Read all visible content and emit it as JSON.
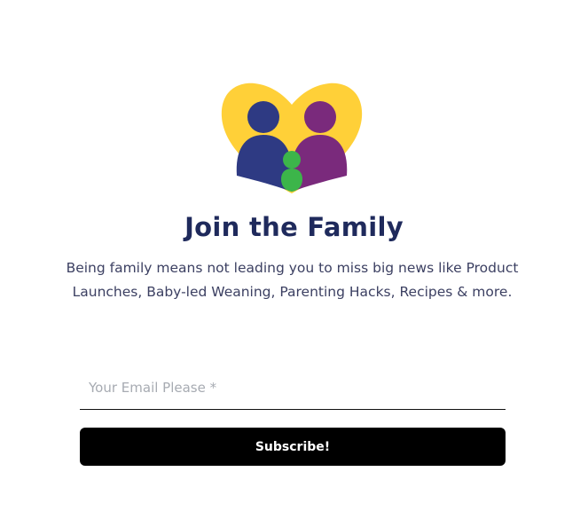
{
  "logo": {
    "icon": "family-heart-icon",
    "colors": {
      "heart": "#ffd038",
      "parent_left": "#2e3a83",
      "parent_right": "#7a2a7c",
      "child": "#3cb54a",
      "accent": "#f2a55a"
    }
  },
  "heading": "Join the Family",
  "description": "Being family means not leading you to miss big news like Product Launches, Baby-led Weaning, Parenting Hacks, Recipes & more.",
  "form": {
    "email_placeholder": "Your Email Please *",
    "email_value": "",
    "subscribe_label": "Subscribe!"
  },
  "colors": {
    "heading": "#1f2a5c",
    "text": "#3c4062",
    "button_bg": "#000000",
    "button_text": "#ffffff"
  }
}
